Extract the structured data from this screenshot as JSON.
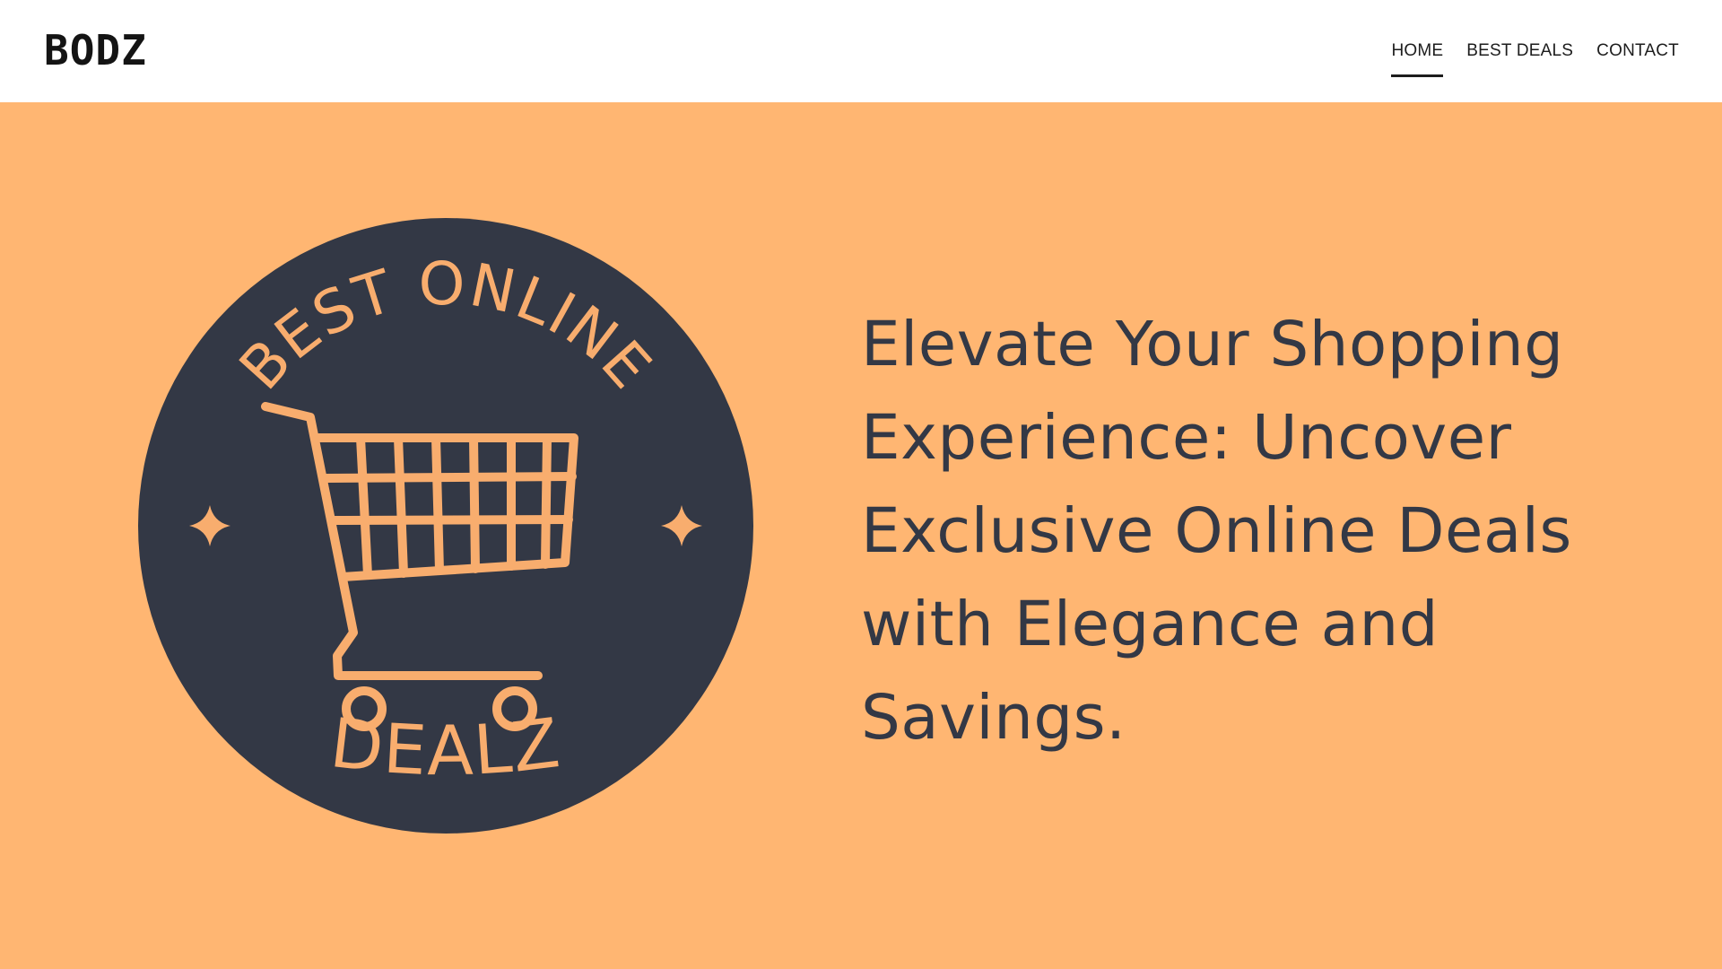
{
  "header": {
    "logo": "BODZ",
    "nav": [
      {
        "label": "HOME",
        "active": true
      },
      {
        "label": "BEST DEALS",
        "active": false
      },
      {
        "label": "CONTACT",
        "active": false
      }
    ]
  },
  "hero": {
    "badge": {
      "top_text": "BEST ONLINE",
      "bottom_text": "DEALZ",
      "icon": "shopping-cart-icon",
      "sparkle_icon": "sparkle-icon"
    },
    "headline": "Elevate Your Shopping Experience: Uncover Exclusive Online Deals with Elegance and Savings."
  },
  "colors": {
    "hero_background": "#ffb672",
    "badge_circle": "#333845",
    "badge_accent": "#f8ad6e",
    "headline_text": "#333845",
    "header_background": "#ffffff"
  }
}
